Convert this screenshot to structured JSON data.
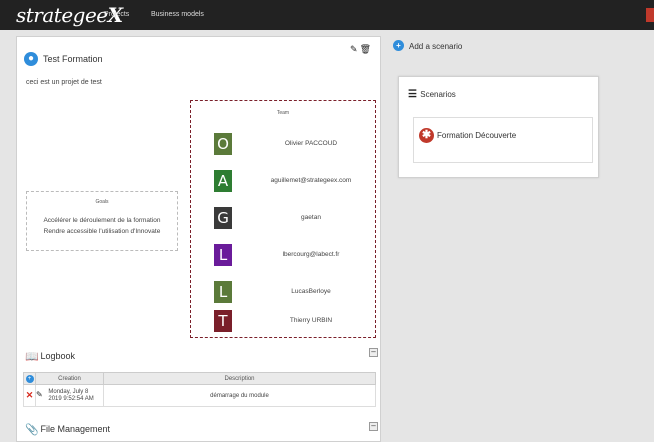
{
  "topbar": {
    "logo_text": "strategee",
    "logo_x": "X",
    "nav": [
      "Projects",
      "Business models"
    ]
  },
  "project": {
    "title": "Test Formation",
    "description": "ceci est un projet de test",
    "team_title": "Team",
    "members": [
      {
        "initial": "O",
        "name": "Olivier PACCOUD",
        "color": "#5b7a3a"
      },
      {
        "initial": "A",
        "name": "aguillemet@strategeex.com",
        "color": "#2e7d32"
      },
      {
        "initial": "G",
        "name": "gaetan",
        "color": "#3a3a3a"
      },
      {
        "initial": "L",
        "name": "lbercourg@labect.fr",
        "color": "#6a1b9a"
      },
      {
        "initial": "L",
        "name": "LucasBerloye",
        "color": "#5b7a3a"
      },
      {
        "initial": "T",
        "name": "Thierry URBIN",
        "color": "#7a1f2a"
      }
    ],
    "goals_title": "Goals",
    "goals": [
      "Accélérer le déroulement de la formation",
      "Rendre accessible l'utilisation d'Innovate"
    ]
  },
  "logbook": {
    "title": "Logbook",
    "columns": [
      "Creation",
      "Description"
    ],
    "rows": [
      {
        "creation_line1": "Monday, July 8",
        "creation_line2": "2019 9:52:54 AM",
        "description": "démarrage du module"
      }
    ]
  },
  "file_management": {
    "title": "File Management"
  },
  "scenarios": {
    "add_label": "Add a scenario",
    "title": "Scenarios",
    "items": [
      {
        "name": "Formation Découverte"
      }
    ]
  },
  "colors": {
    "topbar": "#222222",
    "accent_blue": "#2f8ddb",
    "scenario_red": "#c0392b",
    "team_border": "#7a1f2a"
  }
}
